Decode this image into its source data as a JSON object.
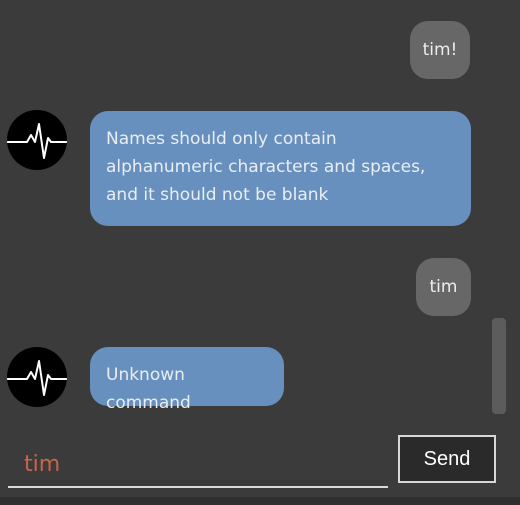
{
  "messages": [
    {
      "sender": "user",
      "text": "tim!"
    },
    {
      "sender": "bot",
      "text": "Names should only contain alphanumeric characters and spaces, and it should not be blank"
    },
    {
      "sender": "user",
      "text": "tim"
    },
    {
      "sender": "bot",
      "text": "Unknown command"
    }
  ],
  "input": {
    "value": "tim",
    "placeholder": ""
  },
  "send_button": {
    "label": "Send"
  },
  "colors": {
    "background": "#3b3b3b",
    "user_bubble": "#676767",
    "bot_bubble": "#6890bf",
    "input_text": "#c8644a"
  },
  "icons": {
    "bot_avatar": "heartbeat-pulse-icon"
  }
}
